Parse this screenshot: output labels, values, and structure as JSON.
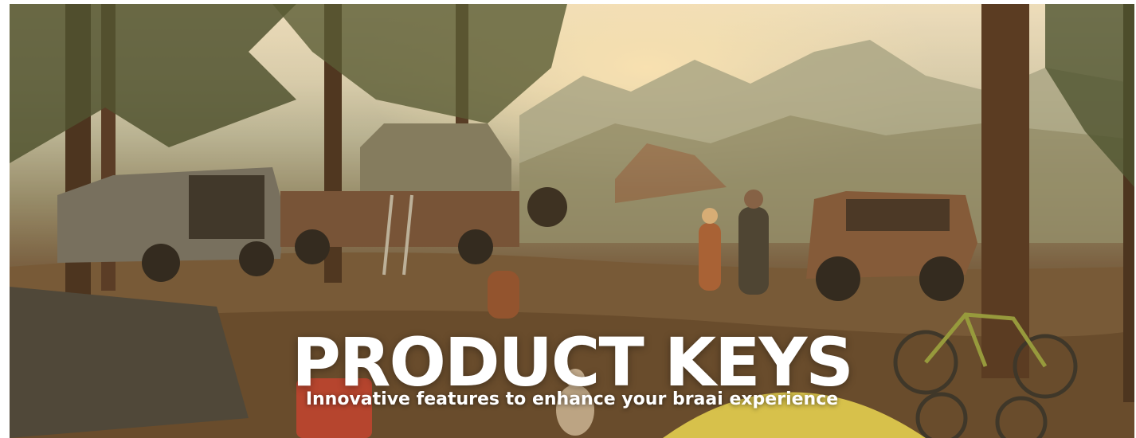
{
  "banner": {
    "title": "PRODUCT KEYS",
    "subtitle": "Innovative features to enhance your braai experience"
  },
  "scene_icons": [
    "pine-tree-icon",
    "suv-icon",
    "rooftop-tent-icon",
    "jeep-icon",
    "bicycle-icon",
    "tent-icon",
    "person-icon",
    "dog-icon",
    "mountain-icon"
  ],
  "colors": {
    "title": "#ffffff",
    "subtitle": "#ffffff",
    "sky": "#f1e6c9",
    "ground": "#5a4329"
  }
}
